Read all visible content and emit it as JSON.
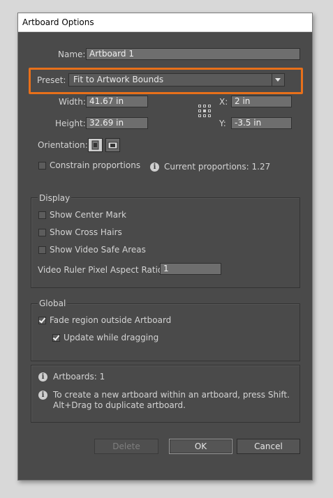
{
  "window": {
    "title": "Artboard Options"
  },
  "artboard": {
    "name_label": "Name:",
    "name_value": "Artboard 1",
    "preset_label": "Preset:",
    "preset_value": "Fit to Artwork Bounds",
    "width_label": "Width:",
    "width_value": "41.67 in",
    "height_label": "Height:",
    "height_value": "32.69 in",
    "x_label": "X:",
    "x_value": "2 in",
    "y_label": "Y:",
    "y_value": "-3.5 in",
    "orientation_label": "Orientation:",
    "constrain_label": "Constrain proportions",
    "constrain_checked": false,
    "proportions_text": "Current proportions: 1.27"
  },
  "display": {
    "group_label": "Display",
    "center_mark_label": "Show Center Mark",
    "center_mark_checked": false,
    "cross_hairs_label": "Show Cross Hairs",
    "cross_hairs_checked": false,
    "video_safe_label": "Show Video Safe Areas",
    "video_safe_checked": false,
    "pixel_ratio_label": "Video Ruler Pixel Aspect Ratio:",
    "pixel_ratio_value": "1"
  },
  "global": {
    "group_label": "Global",
    "fade_label": "Fade region outside Artboard",
    "fade_checked": true,
    "update_label": "Update while dragging",
    "update_checked": true
  },
  "info": {
    "artboards_text": "Artboards: 1",
    "help_line1": "To create a new artboard within an artboard, press Shift.",
    "help_line2": "Alt+Drag to duplicate artboard."
  },
  "buttons": {
    "delete": "Delete",
    "ok": "OK",
    "cancel": "Cancel"
  },
  "colors": {
    "dialog_bg": "#4a4a4a",
    "highlight": "#e8701a",
    "field_bg": "#6e6e6e"
  }
}
